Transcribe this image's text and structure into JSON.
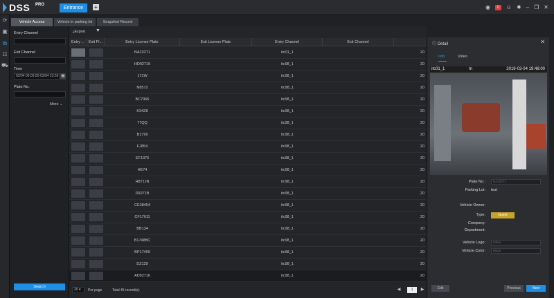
{
  "app": {
    "name": "DSS",
    "edition": "PRO",
    "active_tab": "Entrance",
    "add_tab": "+",
    "alarm_count": "0"
  },
  "icons": {
    "nav": [
      "refresh-icon",
      "video-icon",
      "parking-record-icon",
      "people-icon",
      "vehicle-icon"
    ],
    "topbar": [
      "alarm-icon",
      "user-icon",
      "settings-icon",
      "minimize-icon",
      "restore-icon",
      "close-icon"
    ]
  },
  "subtabs": [
    "Vehicle Access",
    "Vehicle in parking lot",
    "Snapshot Record"
  ],
  "filters": {
    "entry_channel_label": "Entry Channel",
    "exit_channel_label": "Exit Channel",
    "time_label": "Time",
    "time_value": "03/04 00:00:00-03/04 23:59",
    "plate_label": "Plate No.",
    "more_label": "More",
    "search_label": "Search"
  },
  "toolbar": {
    "export_label": "Export"
  },
  "table": {
    "columns": [
      "Entry ...",
      "Exit Pi...",
      "Entry License Plate",
      "Exit License Plate",
      "Entry Channel",
      "Exit Channel",
      ""
    ],
    "rows": [
      {
        "plate": "NA232T1",
        "entry_channel": "itc01_1",
        "extra": "20"
      },
      {
        "plate": "HD92716",
        "entry_channel": "itc98_1",
        "extra": "20"
      },
      {
        "plate": "171W",
        "entry_channel": "itc98_1",
        "extra": "20"
      },
      {
        "plate": "N8572",
        "entry_channel": "itc98_1",
        "extra": "20"
      },
      {
        "plate": "BC7966",
        "entry_channel": "itc98_1",
        "extra": "20"
      },
      {
        "plate": "K34Z8",
        "entry_channel": "itc98_1",
        "extra": "20"
      },
      {
        "plate": "77QQ",
        "entry_channel": "itc98_1",
        "extra": "20"
      },
      {
        "plate": "B1799",
        "entry_channel": "itc98_1",
        "extra": "20"
      },
      {
        "plate": "FJ854",
        "entry_channel": "itc98_1",
        "extra": "20"
      },
      {
        "plate": "EF1376",
        "entry_channel": "itc98_1",
        "extra": "20"
      },
      {
        "plate": "HE74",
        "entry_channel": "itc98_1",
        "extra": "20"
      },
      {
        "plate": "H871JN",
        "entry_channel": "itc98_1",
        "extra": "20"
      },
      {
        "plate": "D9271B",
        "entry_channel": "itc98_1",
        "extra": "20"
      },
      {
        "plate": "CE38454",
        "entry_channel": "itc98_1",
        "extra": "20"
      },
      {
        "plate": "CF17611",
        "entry_channel": "itc98_1",
        "extra": "20"
      },
      {
        "plate": "BB134",
        "entry_channel": "itc98_1",
        "extra": "20"
      },
      {
        "plate": "B1748BC",
        "entry_channel": "itc98_1",
        "extra": "20"
      },
      {
        "plate": "BP17499",
        "entry_channel": "itc98_1",
        "extra": "20"
      },
      {
        "plate": "DZ129",
        "entry_channel": "itc98_1",
        "extra": "20"
      },
      {
        "plate": "AD92716",
        "entry_channel": "itc98_1",
        "extra": "20"
      }
    ]
  },
  "pager": {
    "page_size": "20",
    "per_page_label": "Per page",
    "total_label": "Total 45 record(s).",
    "prev": "◀",
    "next": "▶",
    "current_page": "1"
  },
  "detail": {
    "title": "Detail",
    "tabs": [
      "Info",
      "Video"
    ],
    "snapshot": {
      "channel": "itc01_1",
      "direction": "In",
      "time": "2019-03-04 19:48:00"
    },
    "plate_label": "Plate No.:",
    "plate_value": "NA232T1",
    "parking_label": "Parking Lot:",
    "parking_value": "test",
    "owner_label": "Vehicle Owner:",
    "type_label": "Type:",
    "type_value": "Guest",
    "company_label": "Company:",
    "department_label": "Department:",
    "logo_label": "Vehicle Logo:",
    "logo_value": "Other",
    "color_label": "Vehicle Color:",
    "color_value": "Black",
    "edit_label": "Edit",
    "previous_label": "Previous",
    "next_label": "Next"
  }
}
